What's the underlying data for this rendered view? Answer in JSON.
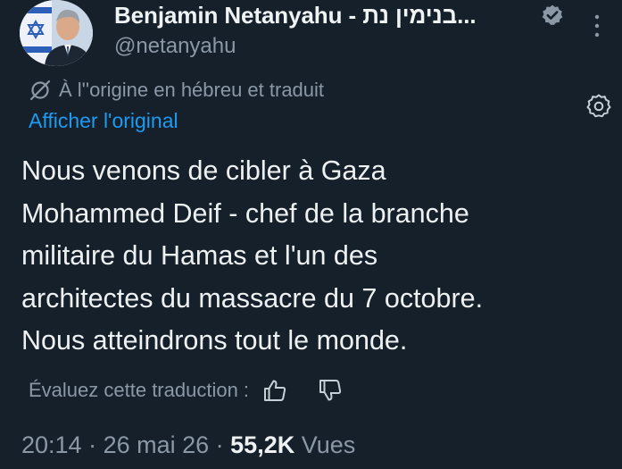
{
  "author": {
    "name": "Benjamin Netanyahu - בנימין נת...",
    "handle": "@netanyahu"
  },
  "translation": {
    "note": "À l''origine en hébreu et traduit",
    "show_original": "Afficher l'original"
  },
  "tweet": {
    "lines": [
      "Nous venons de cibler à Gaza",
      "Mohammed Deif - chef de la branche",
      "militaire du Hamas et l'un des",
      "architectes du massacre du 7 octobre.",
      "Nous atteindrons tout le monde."
    ]
  },
  "rating": {
    "label": "Évaluez cette traduction :"
  },
  "meta": {
    "time": "20:14",
    "sep1": " · ",
    "date": "26 mai 26",
    "sep2": " · ",
    "views_count": "55,2K",
    "views_label": " Vues"
  },
  "icons": {
    "verified": "verified-badge-icon",
    "more": "more-vertical-icon",
    "translate": "translate-icon",
    "settings": "settings-gear-icon",
    "thumb_up": "thumb-up-icon",
    "thumb_down": "thumb-down-icon"
  },
  "colors": {
    "background": "#15202b",
    "link": "#1d9bf0",
    "secondary_text": "#8b98a5",
    "primary_text": "#e7e9ea"
  }
}
